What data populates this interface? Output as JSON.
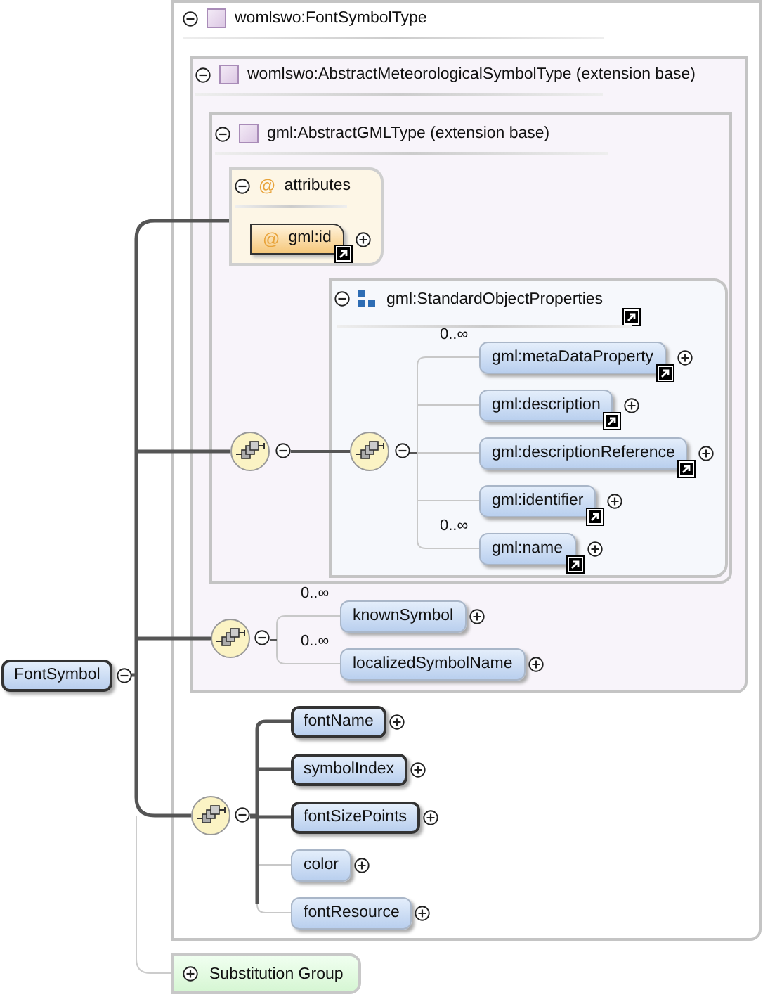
{
  "root": {
    "name": "FontSymbol",
    "required": true
  },
  "type_frame": {
    "title": "womlswo:FontSymbolType",
    "expanded": true,
    "base": {
      "title": "womlswo:AbstractMeteorologicalSymbolType (extension base)",
      "expanded": true,
      "base": {
        "title": "gml:AbstractGMLType (extension base)",
        "expanded": true,
        "attributes": {
          "glyph": "@",
          "title": "attributes",
          "expanded": true,
          "items": [
            {
              "glyph": "@",
              "name": "gml:id",
              "reference": true
            }
          ]
        },
        "group": {
          "title": "gml:StandardObjectProperties",
          "reference": true,
          "expanded": true,
          "elements": [
            {
              "name": "gml:metaDataProperty",
              "cardinality": "0..∞",
              "required": false,
              "reference": true
            },
            {
              "name": "gml:description",
              "required": false,
              "reference": true
            },
            {
              "name": "gml:descriptionReference",
              "required": false,
              "reference": true
            },
            {
              "name": "gml:identifier",
              "required": false,
              "reference": true
            },
            {
              "name": "gml:name",
              "cardinality": "0..∞",
              "required": false,
              "reference": true
            }
          ]
        }
      },
      "elements": [
        {
          "name": "knownSymbol",
          "cardinality": "0..∞",
          "required": false,
          "reference": false
        },
        {
          "name": "localizedSymbolName",
          "cardinality": "0..∞",
          "required": false,
          "reference": false
        }
      ]
    },
    "elements": [
      {
        "name": "fontName",
        "required": true,
        "reference": false
      },
      {
        "name": "symbolIndex",
        "required": true,
        "reference": false
      },
      {
        "name": "fontSizePoints",
        "required": true,
        "reference": false
      },
      {
        "name": "color",
        "required": false,
        "reference": false
      },
      {
        "name": "fontResource",
        "required": false,
        "reference": false
      }
    ]
  },
  "substitution_group": {
    "label": "Substitution Group",
    "expanded": false
  }
}
